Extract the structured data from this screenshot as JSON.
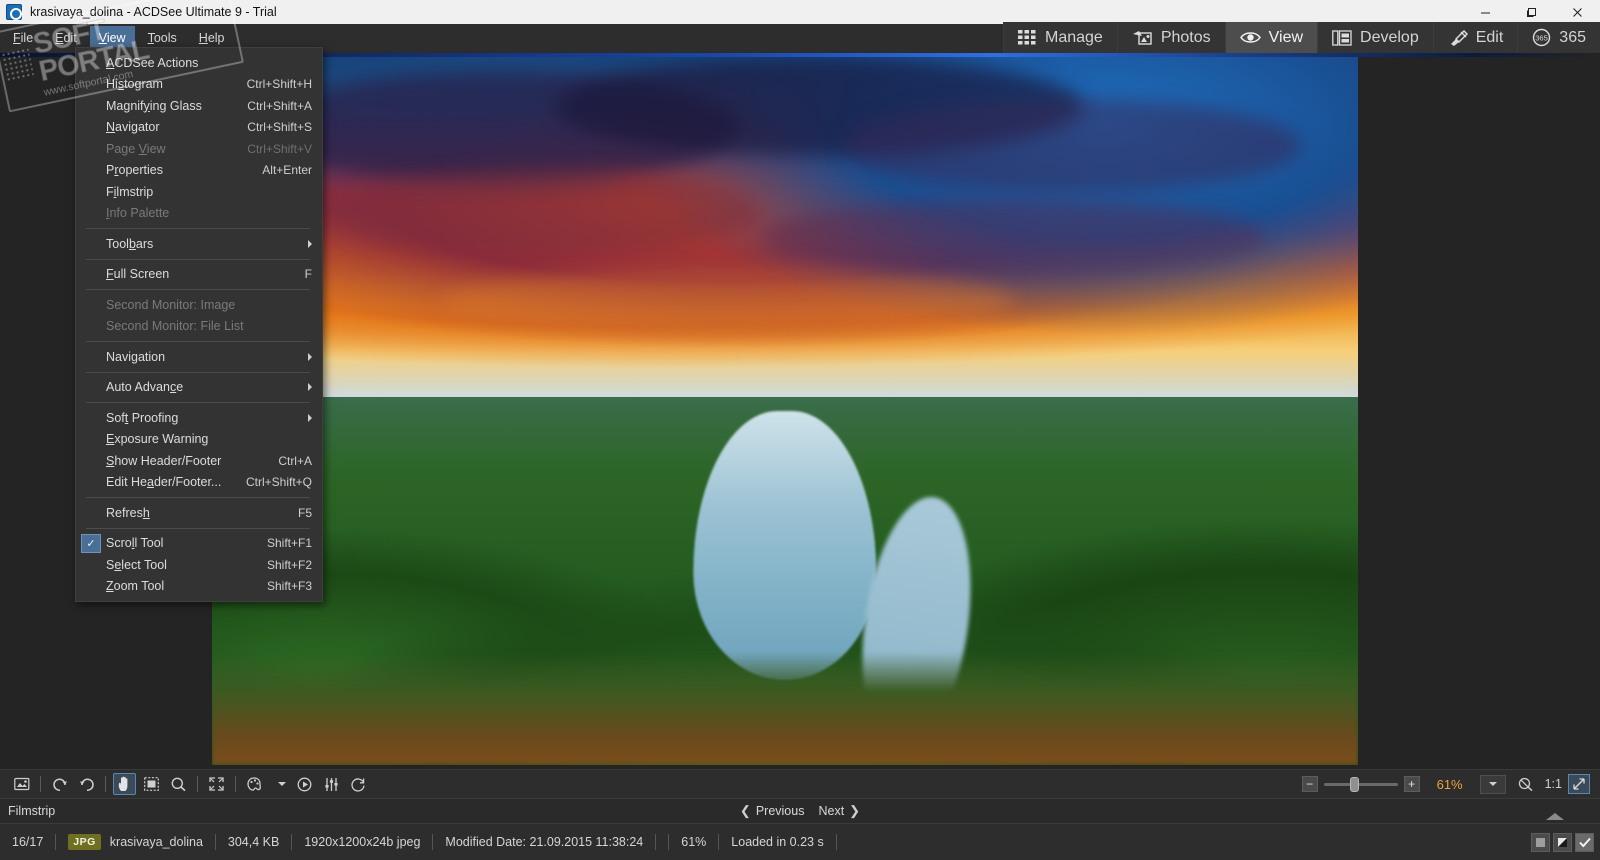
{
  "window": {
    "title": "krasivaya_dolina - ACDSee Ultimate 9 - Trial",
    "app_icon": "acdsee-logo-icon",
    "controls": {
      "minimize": "Minimize",
      "maximize": "Maximize",
      "close": "Close"
    }
  },
  "menubar": {
    "items": [
      {
        "label": "File",
        "mnemonic": "F",
        "active": false
      },
      {
        "label": "Edit",
        "mnemonic": "E",
        "active": false
      },
      {
        "label": "View",
        "mnemonic": "V",
        "active": true
      },
      {
        "label": "Tools",
        "mnemonic": "T",
        "active": false
      },
      {
        "label": "Help",
        "mnemonic": "H",
        "active": false
      }
    ]
  },
  "modes": {
    "tabs": [
      {
        "label": "Manage",
        "icon": "grid-icon",
        "active": false
      },
      {
        "label": "Photos",
        "icon": "photos-icon",
        "active": false
      },
      {
        "label": "View",
        "icon": "eye-icon",
        "active": true
      },
      {
        "label": "Develop",
        "icon": "develop-icon",
        "active": false
      },
      {
        "label": "Edit",
        "icon": "edit-brush-icon",
        "active": false
      },
      {
        "label": "365",
        "icon": "365-icon",
        "active": false
      }
    ]
  },
  "view_menu": {
    "groups": [
      {
        "items": [
          {
            "label": "ACDSee Actions",
            "mnemonic": "A",
            "accel": "",
            "disabled": false,
            "submenu": false,
            "checked": false
          },
          {
            "label": "Histogram",
            "mnemonic": "s",
            "accel": "Ctrl+Shift+H",
            "disabled": false,
            "submenu": false,
            "checked": false
          },
          {
            "label": "Magnifying Glass",
            "mnemonic": "y",
            "accel": "Ctrl+Shift+A",
            "disabled": false,
            "submenu": false,
            "checked": false
          },
          {
            "label": "Navigator",
            "mnemonic": "N",
            "accel": "Ctrl+Shift+S",
            "disabled": false,
            "submenu": false,
            "checked": false
          },
          {
            "label": "Page View",
            "mnemonic": "V",
            "accel": "Ctrl+Shift+V",
            "disabled": true,
            "submenu": false,
            "checked": false
          },
          {
            "label": "Properties",
            "mnemonic": "r",
            "accel": "Alt+Enter",
            "disabled": false,
            "submenu": false,
            "checked": false
          },
          {
            "label": "Filmstrip",
            "mnemonic": "i",
            "accel": "",
            "disabled": false,
            "submenu": false,
            "checked": false
          },
          {
            "label": "Info Palette",
            "mnemonic": "I",
            "accel": "",
            "disabled": true,
            "submenu": false,
            "checked": false
          }
        ]
      },
      {
        "items": [
          {
            "label": "Toolbars",
            "mnemonic": "b",
            "accel": "",
            "disabled": false,
            "submenu": true,
            "checked": false
          }
        ]
      },
      {
        "items": [
          {
            "label": "Full Screen",
            "mnemonic": "F",
            "accel": "F",
            "disabled": false,
            "submenu": false,
            "checked": false
          }
        ]
      },
      {
        "items": [
          {
            "label": "Second Monitor: Image",
            "mnemonic": "",
            "accel": "",
            "disabled": true,
            "submenu": false,
            "checked": false
          },
          {
            "label": "Second Monitor: File List",
            "mnemonic": "",
            "accel": "",
            "disabled": true,
            "submenu": false,
            "checked": false
          }
        ]
      },
      {
        "items": [
          {
            "label": "Navigation",
            "mnemonic": "g",
            "accel": "",
            "disabled": false,
            "submenu": true,
            "checked": false
          }
        ]
      },
      {
        "items": [
          {
            "label": "Auto Advance",
            "mnemonic": "c",
            "accel": "",
            "disabled": false,
            "submenu": true,
            "checked": false
          }
        ]
      },
      {
        "items": [
          {
            "label": "Soft Proofing",
            "mnemonic": "t",
            "accel": "",
            "disabled": false,
            "submenu": true,
            "checked": false
          },
          {
            "label": "Exposure Warning",
            "mnemonic": "E",
            "accel": "",
            "disabled": false,
            "submenu": false,
            "checked": false
          },
          {
            "label": "Show Header/Footer",
            "mnemonic": "S",
            "accel": "Ctrl+A",
            "disabled": false,
            "submenu": false,
            "checked": false
          },
          {
            "label": "Edit Header/Footer...",
            "mnemonic": "a",
            "accel": "Ctrl+Shift+Q",
            "disabled": false,
            "submenu": false,
            "checked": false
          }
        ]
      },
      {
        "items": [
          {
            "label": "Refresh",
            "mnemonic": "h",
            "accel": "F5",
            "disabled": false,
            "submenu": false,
            "checked": false
          }
        ]
      },
      {
        "items": [
          {
            "label": "Scroll Tool",
            "mnemonic": "l",
            "accel": "Shift+F1",
            "disabled": false,
            "submenu": false,
            "checked": true
          },
          {
            "label": "Select Tool",
            "mnemonic": "e",
            "accel": "Shift+F2",
            "disabled": false,
            "submenu": false,
            "checked": false
          },
          {
            "label": "Zoom Tool",
            "mnemonic": "Z",
            "accel": "Shift+F3",
            "disabled": false,
            "submenu": false,
            "checked": false
          }
        ]
      }
    ]
  },
  "watermark": {
    "title": "SOFT PORTAL",
    "line1": "SOFT",
    "line2": "PORTAL",
    "url": "www.softportal.com"
  },
  "toolbar": {
    "buttons": [
      {
        "icon": "save-image-icon",
        "name": "save-button",
        "selected": false,
        "disabled": false
      },
      {
        "icon": "rotate-left-icon",
        "name": "rotate-left-button",
        "selected": false,
        "disabled": false
      },
      {
        "icon": "rotate-right-icon",
        "name": "rotate-right-button",
        "selected": false,
        "disabled": false
      },
      {
        "icon": "hand-scroll-icon",
        "name": "scroll-tool-button",
        "selected": true,
        "disabled": false
      },
      {
        "icon": "select-marquee-icon",
        "name": "select-tool-button",
        "selected": false,
        "disabled": false
      },
      {
        "icon": "zoom-tool-icon",
        "name": "zoom-tool-button",
        "selected": false,
        "disabled": false
      },
      {
        "icon": "fullscreen-icon",
        "name": "full-screen-button",
        "selected": false,
        "disabled": false
      },
      {
        "icon": "palette-icon",
        "name": "color-palette-button",
        "selected": false,
        "disabled": false
      },
      {
        "icon": "play-slideshow-icon",
        "name": "slideshow-button",
        "selected": false,
        "disabled": false
      },
      {
        "icon": "adjust-sliders-icon",
        "name": "adjust-button",
        "selected": false,
        "disabled": false
      },
      {
        "icon": "clock-rotate-icon",
        "name": "history-button",
        "selected": false,
        "disabled": false
      }
    ],
    "zoom": {
      "minus": "−",
      "plus": "+",
      "value": "61%",
      "dropdown": "chevron-down-icon",
      "reset_icon": "zoom-reset-icon",
      "ratio_label": "1:1",
      "fit_icon": "fit-to-window-icon"
    }
  },
  "filmstrip": {
    "label": "Filmstrip",
    "previous": "Previous",
    "next": "Next"
  },
  "status": {
    "counter": "16/17",
    "format_badge": "JPG",
    "filename": "krasivaya_dolina",
    "filesize": "304,4 KB",
    "dimensions": "1920x1200x24b jpeg",
    "modified": "Modified Date: 21.09.2015 11:38:24",
    "zoom": "61%",
    "loaded": "Loaded in 0.23 s",
    "view_modes": [
      {
        "name": "view-mode-normal",
        "icon": "square-icon",
        "active": false
      },
      {
        "name": "view-mode-split",
        "icon": "split-icon",
        "active": false
      },
      {
        "name": "view-mode-check",
        "icon": "check-icon",
        "active": true
      }
    ]
  },
  "colors": {
    "accent_blue": "#2f6fe0",
    "menu_bg": "#333333",
    "chrome_bg": "#2d2d2d",
    "zoom_text": "#e8a53a",
    "selection": "#4a6f96"
  }
}
